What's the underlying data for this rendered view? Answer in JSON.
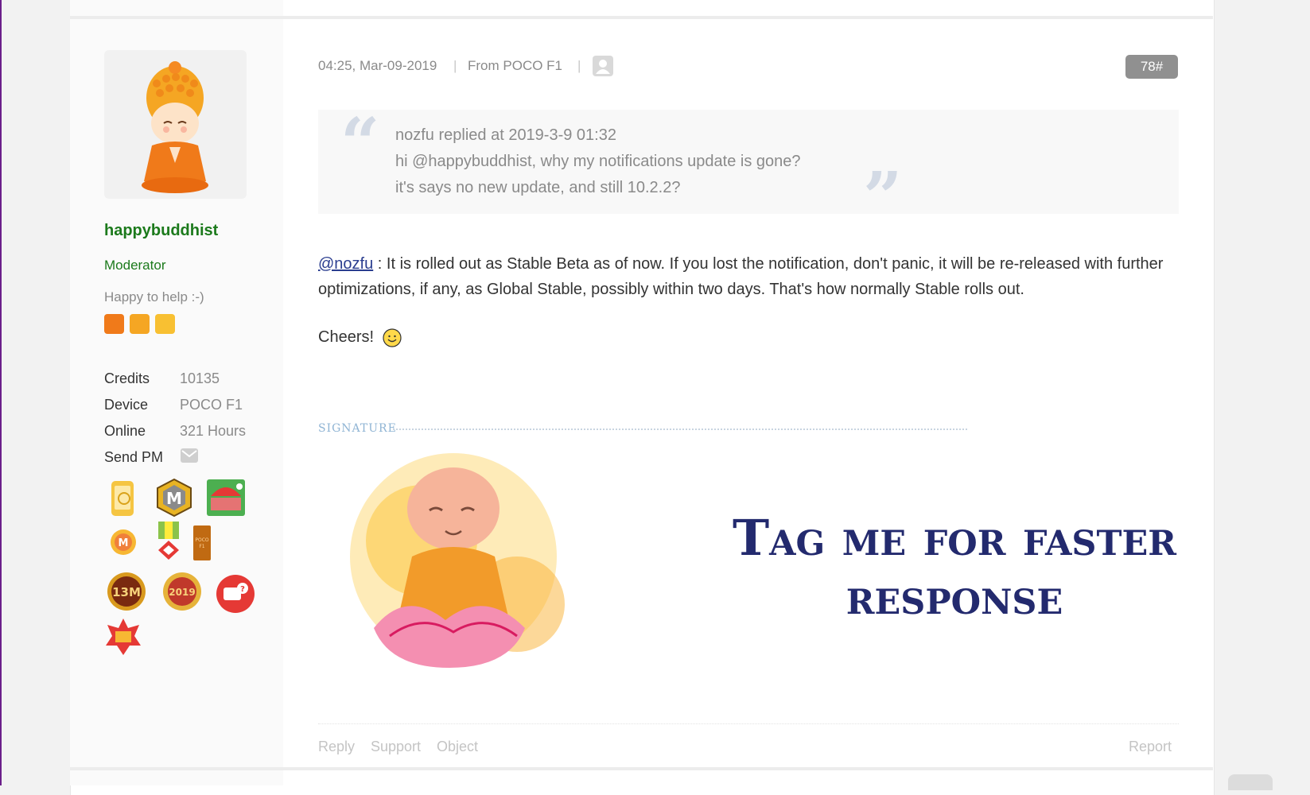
{
  "author": {
    "username": "happybuddhist",
    "group": "Moderator",
    "title": "Happy to help :-)",
    "stats": [
      {
        "label": "Credits",
        "value": "10135"
      },
      {
        "label": "Device",
        "value": "POCO F1"
      },
      {
        "label": "Online",
        "value": "321 Hours"
      },
      {
        "label": "Send PM",
        "value": ""
      }
    ]
  },
  "post": {
    "timestamp": "04:25, Mar-09-2019",
    "from": "From POCO F1",
    "separator": "|",
    "floor": "78#",
    "quote": {
      "header": "nozfu replied at 2019-3-9 01:32",
      "line1": "hi @happybuddhist, why my notifications update is gone?",
      "line2": "it's says no new update, and still 10.2.2?"
    },
    "mention": "@nozfu",
    "body": " : It is rolled out as Stable Beta as of now. If you lost the notification, don't panic, it will be re-released with further optimizations, if any, as Global Stable, possibly within two days. That's how normally Stable rolls out.",
    "cheers": "Cheers!",
    "signature_label": "SIGNATURE",
    "signature_text_line1": "Tag me for faster",
    "signature_text_line2": "response"
  },
  "footer": {
    "reply": "Reply",
    "support": "Support",
    "object": "Object",
    "report": "Report"
  },
  "colors": {
    "username": "#1c7a1c",
    "mention": "#2a3d8f",
    "signature": "#232a6e"
  }
}
